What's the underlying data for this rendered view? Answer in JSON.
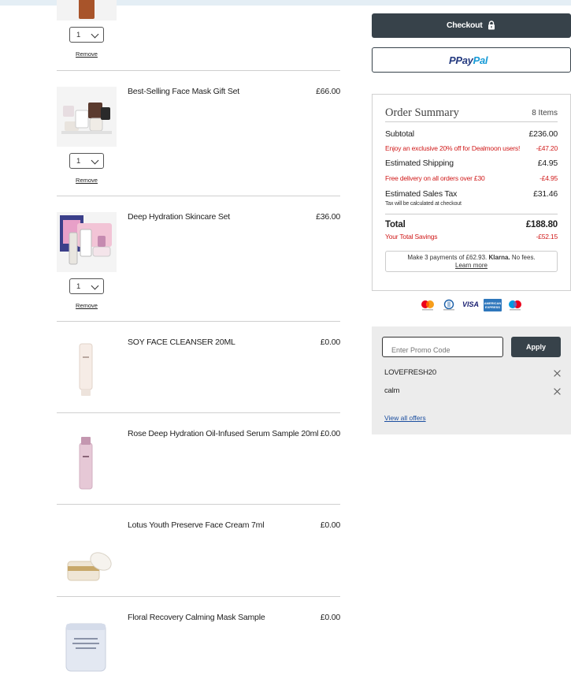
{
  "cart": {
    "quantity_options_selected": "1",
    "remove_label": "Remove",
    "items": [
      {
        "name": "",
        "price": "",
        "qty": "1",
        "image": "amber-bottle-thumbnail"
      },
      {
        "name": "Best-Selling Face Mask Gift Set",
        "price": "£66.00",
        "qty": "1",
        "image": "mask-gift-set-thumbnail"
      },
      {
        "name": "Deep Hydration Skincare Set",
        "price": "£36.00",
        "qty": "1",
        "image": "hydration-set-thumbnail"
      },
      {
        "name": "SOY FACE CLEANSER 20ML",
        "price": "£0.00",
        "image": "cleanser-tube-thumbnail"
      },
      {
        "name": "Rose Deep Hydration Oil-Infused Serum Sample 20ml",
        "price": "£0.00",
        "image": "serum-bottle-thumbnail"
      },
      {
        "name": "Lotus Youth Preserve Face Cream 7ml",
        "price": "£0.00",
        "image": "cream-jar-thumbnail"
      },
      {
        "name": "Floral Recovery Calming Mask Sample",
        "price": "£0.00",
        "image": "mask-jar-thumbnail"
      }
    ]
  },
  "checkout": {
    "checkout_label": "Checkout",
    "paypal_label_a": "Pay",
    "paypal_label_b": "Pal"
  },
  "summary": {
    "title": "Order Summary",
    "items_count": "8 Items",
    "subtotal_label": "Subtotal",
    "subtotal_value": "£236.00",
    "discount_label": "Enjoy an exclusive 20% off for Dealmoon users!",
    "discount_value": "-£47.20",
    "shipping_label": "Estimated Shipping",
    "shipping_value": "£4.95",
    "free_delivery_label": "Free delivery on all orders over £30",
    "free_delivery_value": "-£4.95",
    "tax_label": "Estimated Sales Tax",
    "tax_value": "£31.46",
    "tax_note": "Tax will be calculated at checkout",
    "total_label": "Total",
    "total_value": "£188.80",
    "savings_label": "Your Total Savings",
    "savings_value": "-£52.15",
    "klarna_prefix": "Make 3 payments of £62.93.",
    "klarna_brand": "Klarna.",
    "klarna_suffix": "No fees.",
    "klarna_link": "Learn more"
  },
  "payment_icons": [
    "mastercard-icon",
    "diners-club-icon",
    "visa-icon",
    "amex-icon",
    "maestro-icon"
  ],
  "payment_labels": {
    "visa": "VISA",
    "amex": "AMERICAN EXPRESS"
  },
  "promo": {
    "placeholder": "Enter Promo Code",
    "apply_label": "Apply",
    "codes": [
      "LOVEFRESH20",
      "calm"
    ],
    "view_all": "View all offers"
  },
  "colors": {
    "dark_button": "#37424a",
    "discount_red": "#d01a1a",
    "link_blue": "#1c4fa0",
    "promo_bg": "#ececec"
  }
}
